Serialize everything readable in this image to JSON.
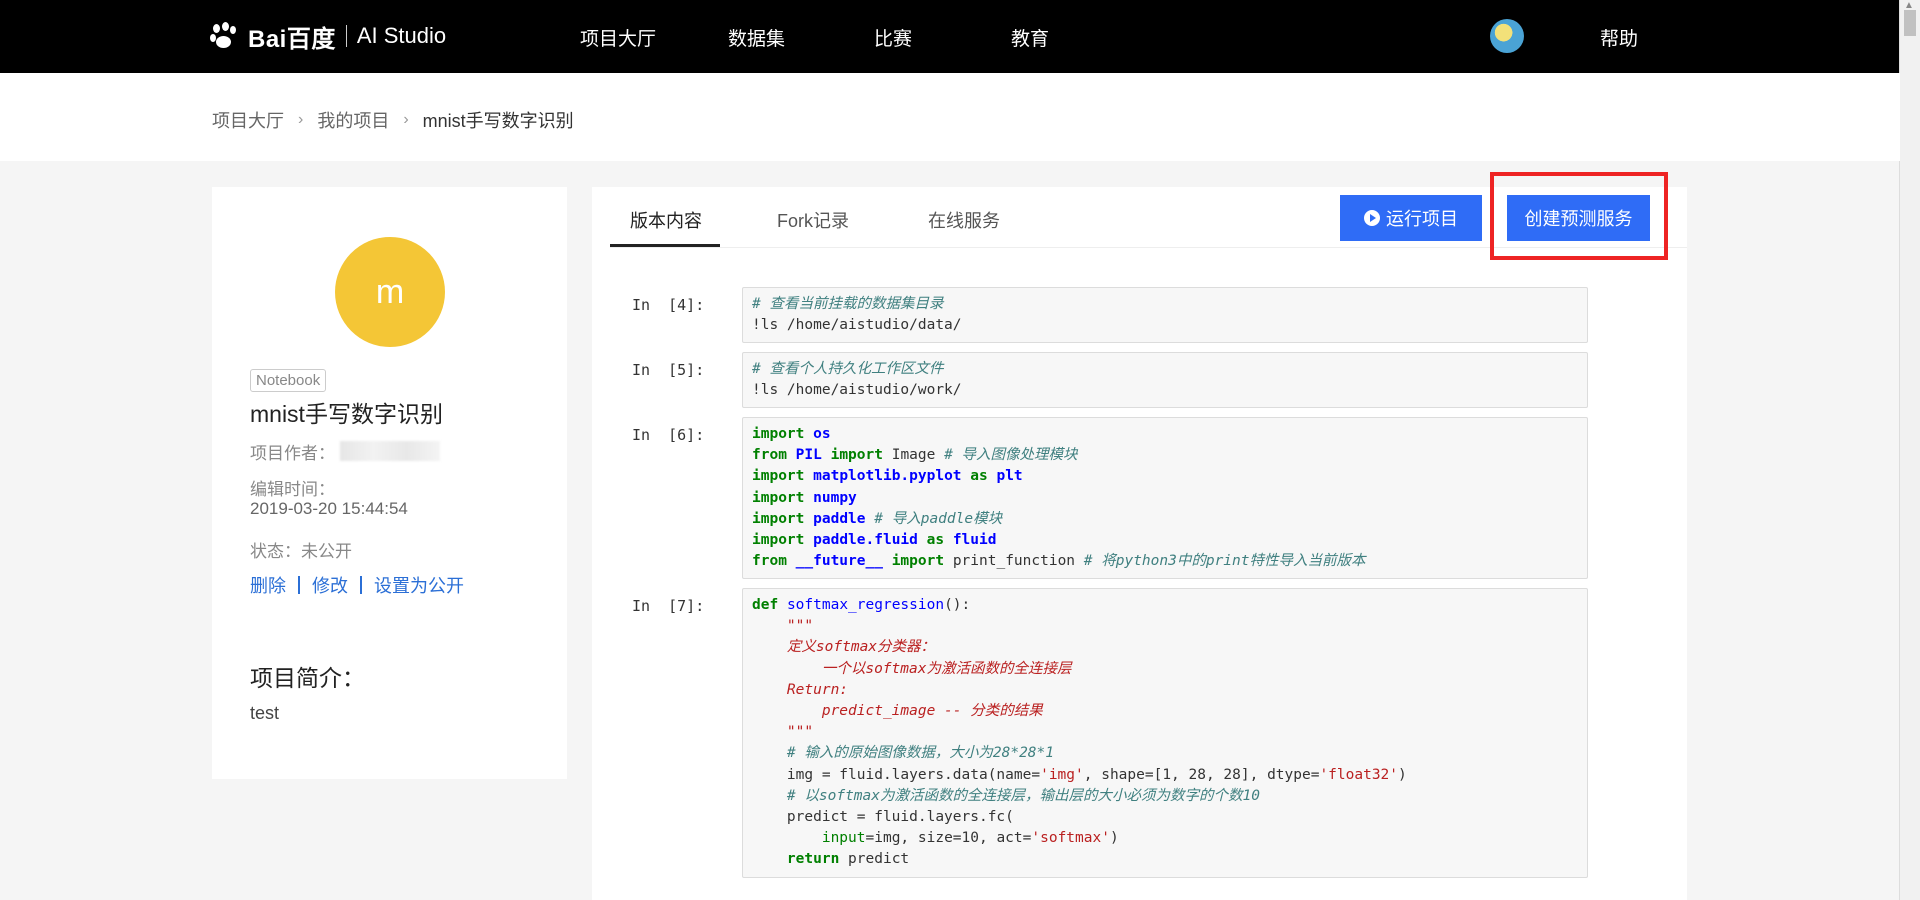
{
  "header": {
    "logo_brand": "Bai百度",
    "logo_product": "AI Studio",
    "nav": [
      {
        "label": "项目大厅"
      },
      {
        "label": "数据集"
      },
      {
        "label": "比赛"
      },
      {
        "label": "教育"
      }
    ],
    "help": "帮助"
  },
  "breadcrumb": {
    "items": [
      "项目大厅",
      "我的项目",
      "mnist手写数字识别"
    ]
  },
  "project": {
    "avatar_letter": "m",
    "badge": "Notebook",
    "title": "mnist手写数字识别",
    "author_label": "项目作者：",
    "edit_time_label": "编辑时间：",
    "edit_time": "2019-03-20 15:44:54",
    "status": "状态：未公开",
    "actions": [
      "删除",
      "修改",
      "设置为公开"
    ],
    "intro_title": "项目简介：",
    "intro_text": "test"
  },
  "tabs": [
    {
      "label": "版本内容",
      "active": true
    },
    {
      "label": "Fork记录",
      "active": false
    },
    {
      "label": "在线服务",
      "active": false
    }
  ],
  "buttons": {
    "run": "运行项目",
    "create_service": "创建预测服务"
  },
  "colors": {
    "accent": "#2f6cf6",
    "highlight": "#ee2424",
    "avatar": "#f4c636"
  },
  "cells": [
    {
      "prompt": "In  [4]:",
      "lines": [
        [
          [
            "c",
            "# 查看当前挂载的数据集目录"
          ]
        ],
        [
          [
            "p",
            "!ls /home/aistudio/data/"
          ]
        ]
      ]
    },
    {
      "prompt": "In  [5]:",
      "lines": [
        [
          [
            "c",
            "# 查看个人持久化工作区文件"
          ]
        ],
        [
          [
            "p",
            "!ls /home/aistudio/work/"
          ]
        ]
      ]
    },
    {
      "prompt": "In  [6]:",
      "lines": [
        [
          [
            "k",
            "import"
          ],
          [
            "p",
            " "
          ],
          [
            "m",
            "os"
          ]
        ],
        [
          [
            "k",
            "from"
          ],
          [
            "p",
            " "
          ],
          [
            "m",
            "PIL"
          ],
          [
            "p",
            " "
          ],
          [
            "k",
            "import"
          ],
          [
            "p",
            " Image "
          ],
          [
            "c",
            "# 导入图像处理模块"
          ]
        ],
        [
          [
            "k",
            "import"
          ],
          [
            "p",
            " "
          ],
          [
            "m",
            "matplotlib.pyplot"
          ],
          [
            "p",
            " "
          ],
          [
            "k",
            "as"
          ],
          [
            "p",
            " "
          ],
          [
            "m",
            "plt"
          ]
        ],
        [
          [
            "k",
            "import"
          ],
          [
            "p",
            " "
          ],
          [
            "m",
            "numpy"
          ]
        ],
        [
          [
            "k",
            "import"
          ],
          [
            "p",
            " "
          ],
          [
            "m",
            "paddle"
          ],
          [
            "p",
            " "
          ],
          [
            "c",
            "# 导入paddle模块"
          ]
        ],
        [
          [
            "k",
            "import"
          ],
          [
            "p",
            " "
          ],
          [
            "m",
            "paddle.fluid"
          ],
          [
            "p",
            " "
          ],
          [
            "k",
            "as"
          ],
          [
            "p",
            " "
          ],
          [
            "m",
            "fluid"
          ]
        ],
        [
          [
            "k",
            "from"
          ],
          [
            "p",
            " "
          ],
          [
            "m",
            "__future__"
          ],
          [
            "p",
            " "
          ],
          [
            "k",
            "import"
          ],
          [
            "p",
            " print_function "
          ],
          [
            "c",
            "# 将python3中的print特性导入当前版本"
          ]
        ]
      ]
    },
    {
      "prompt": "In  [7]:",
      "lines": [
        [
          [
            "k",
            "def"
          ],
          [
            "p",
            " "
          ],
          [
            "f",
            "softmax_regression"
          ],
          [
            "p",
            "():"
          ]
        ],
        [
          [
            "d",
            "    \"\"\""
          ]
        ],
        [
          [
            "d",
            "    定义softmax分类器："
          ]
        ],
        [
          [
            "d",
            "        一个以softmax为激活函数的全连接层"
          ]
        ],
        [
          [
            "d",
            "    Return:"
          ]
        ],
        [
          [
            "d",
            "        predict_image -- 分类的结果"
          ]
        ],
        [
          [
            "d",
            "    \"\"\""
          ]
        ],
        [
          [
            "c",
            "    # 输入的原始图像数据，大小为28*28*1"
          ]
        ],
        [
          [
            "p",
            "    img = fluid.layers.data(name="
          ],
          [
            "s",
            "'img'"
          ],
          [
            "p",
            ", shape=[1, 28, 28], dtype="
          ],
          [
            "s",
            "'float32'"
          ],
          [
            "p",
            ")"
          ]
        ],
        [
          [
            "c",
            "    # 以softmax为激活函数的全连接层，输出层的大小必须为数字的个数10"
          ]
        ],
        [
          [
            "p",
            "    predict = fluid.layers.fc("
          ]
        ],
        [
          [
            "a",
            "        input"
          ],
          [
            "p",
            "=img, size=10, act="
          ],
          [
            "s",
            "'softmax'"
          ],
          [
            "p",
            ")"
          ]
        ],
        [
          [
            "k",
            "    return"
          ],
          [
            "p",
            " predict"
          ]
        ]
      ]
    }
  ]
}
